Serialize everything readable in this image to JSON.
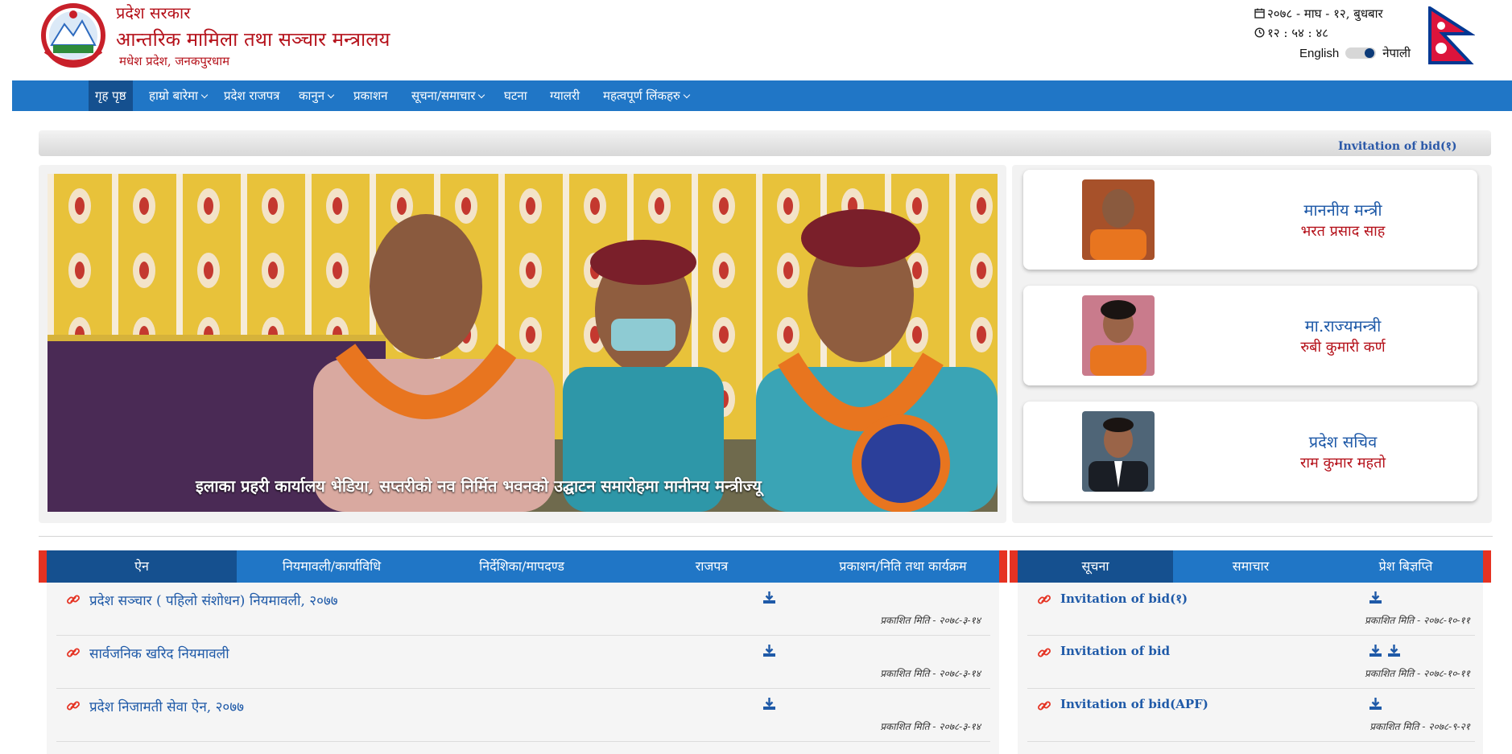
{
  "header": {
    "org_line1": "प्रदेश सरकार",
    "org_line2": "आन्तरिक मामिला तथा सञ्चार मन्त्रालय",
    "org_line3": "मधेश प्रदेश, जनकपुरधाम",
    "date": "२०७८ - माघ - १२, बुधबार",
    "time": "१२ : ५४ : ४८",
    "lang_en": "English",
    "lang_np": "नेपाली",
    "icons": {
      "date": "calendar-icon",
      "time": "clock-icon"
    }
  },
  "nav": {
    "items": [
      {
        "label": "गृह पृष्ठ",
        "dropdown": false,
        "active": true
      },
      {
        "label": "हाम्रो बारेमा",
        "dropdown": true
      },
      {
        "label": "प्रदेश राजपत्र",
        "dropdown": false
      },
      {
        "label": "कानुन",
        "dropdown": true
      },
      {
        "label": "प्रकाशन",
        "dropdown": false
      },
      {
        "label": "सूचना/समाचार",
        "dropdown": true
      },
      {
        "label": "घटना",
        "dropdown": false
      },
      {
        "label": "ग्यालरी",
        "dropdown": false
      },
      {
        "label": "महत्वपूर्ण लिंकहरु",
        "dropdown": true
      }
    ]
  },
  "ticker": {
    "text": "Invitation of bid(१)"
  },
  "slider": {
    "caption": "इलाका प्रहरी कार्यालय भेडिया, सप्तरीको नव निर्मित भवनको उद्घाटन समारोहमा मानीनय मन्त्रीज्यू"
  },
  "officials": [
    {
      "title": "माननीय मन्त्री",
      "name": "भरत प्रसाद साह"
    },
    {
      "title": "मा.राज्यमन्त्री",
      "name": "रुबी कुमारी कर्ण"
    },
    {
      "title": "प्रदेश सचिव",
      "name": "राम कुमार महतो"
    }
  ],
  "left_panel": {
    "tabs": [
      "ऐन",
      "नियमावली/कार्याविधि",
      "निर्देशिका/मापदण्ड",
      "राजपत्र",
      "प्रकाशन/निति तथा कार्यक्रम"
    ],
    "active_tab": 0,
    "rows": [
      {
        "title": "प्रदेश सञ्चार ( पहिलो संशोधन) नियमावली, २०७७",
        "date": "प्रकाशित मिति - २०७८-३-१४",
        "downloads": 1
      },
      {
        "title": "सार्वजनिक खरिद नियमावली",
        "date": "प्रकाशित मिति - २०७८-३-१४",
        "downloads": 1
      },
      {
        "title": "प्रदेश निजामती सेवा ऐन, २०७७",
        "date": "प्रकाशित मिति - २०७८-३-१४",
        "downloads": 1
      }
    ]
  },
  "right_panel": {
    "tabs": [
      "सूचना",
      "समाचार",
      "प्रेश बिज्ञप्ति"
    ],
    "active_tab": 0,
    "rows": [
      {
        "title": "Invitation of bid(१)",
        "date": "प्रकाशित मिति - २०७८-१०-११",
        "downloads": 1
      },
      {
        "title": "Invitation of bid",
        "date": "प्रकाशित मिति - २०७८-१०-११",
        "downloads": 2
      },
      {
        "title": "Invitation of bid(APF)",
        "date": "प्रकाशित मिति - २०७८-९-२१",
        "downloads": 1
      }
    ]
  },
  "colors": {
    "primary": "#2076c6",
    "primary_dark": "#15508f",
    "accent_red": "#b5121b",
    "link_blue": "#1f5aa8",
    "edge_red": "#e53222"
  }
}
